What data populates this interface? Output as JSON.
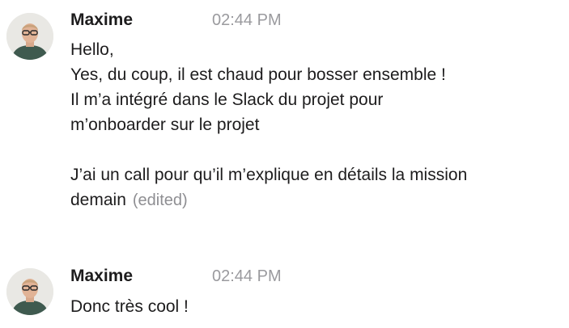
{
  "messages": [
    {
      "author": "Maxime",
      "timestamp": "02:44 PM",
      "lines": [
        "Hello,",
        "Yes, du coup, il est chaud pour bosser ensemble !",
        "Il m’a intégré dans le Slack du projet pour",
        "m’onboarder sur le projet",
        "",
        "J’ai un call pour qu’il m’explique en détails la mission",
        "demain"
      ],
      "edited_label": "(edited)"
    },
    {
      "author": "Maxime",
      "timestamp": "02:44 PM",
      "lines": [
        "Donc très cool !"
      ]
    }
  ]
}
